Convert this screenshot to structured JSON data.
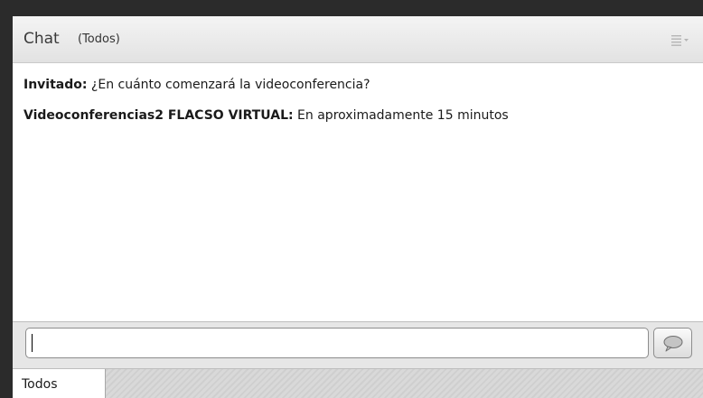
{
  "header": {
    "title": "Chat",
    "subtitle": "(Todos)",
    "menu_icon": "pod-options-menu-icon"
  },
  "messages": [
    {
      "sender": "Invitado:",
      "text": " ¿En cuánto comenzará la videoconferencia?"
    },
    {
      "sender": "Videoconferencias2 FLACSO VIRTUAL:",
      "text": " En aproximadamente 15 minutos"
    }
  ],
  "input": {
    "value": "",
    "placeholder": ""
  },
  "send_icon": "speech-bubble-icon",
  "tabs": [
    {
      "label": "Todos"
    }
  ]
}
